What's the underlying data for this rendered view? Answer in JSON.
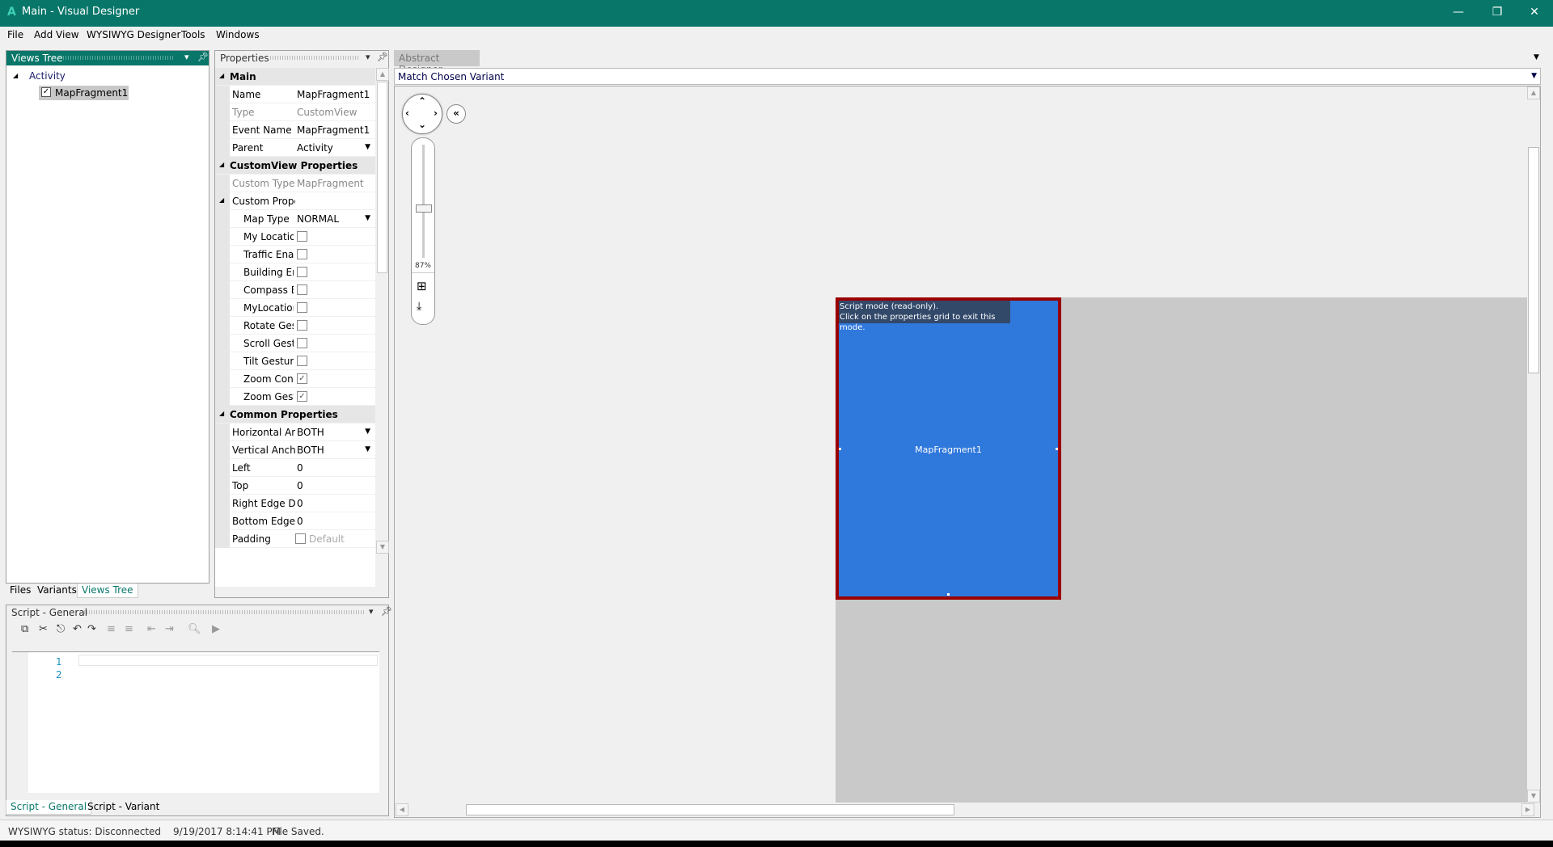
{
  "window": {
    "title": "Main - Visual Designer",
    "logo": "A",
    "controls": [
      "minimize-icon",
      "restore-icon",
      "close-icon"
    ]
  },
  "menu": [
    "File",
    "Add View",
    "WYSIWYG Designer",
    "Tools",
    "Windows"
  ],
  "views_tree": {
    "title": "Views Tree",
    "root": "Activity",
    "child": "MapFragment1",
    "child_checked": true,
    "tabs": [
      "Files",
      "Variants",
      "Views Tree"
    ],
    "active_tab": "Views Tree"
  },
  "properties": {
    "title": "Properties",
    "main": {
      "label": "Main",
      "rows": [
        [
          "Name",
          "MapFragment1"
        ],
        [
          "Type",
          "CustomView"
        ],
        [
          "Event Name",
          "MapFragment1"
        ],
        [
          "Parent",
          "Activity"
        ]
      ]
    },
    "custom": {
      "label": "CustomView Properties",
      "custom_type": [
        "Custom Type",
        "MapFragment"
      ],
      "custom_props": "Custom Prope",
      "map_type": [
        "Map Type",
        "NORMAL"
      ],
      "checks": [
        [
          "My Locatio",
          false
        ],
        [
          "Traffic Enal",
          false
        ],
        [
          "Building Er",
          false
        ],
        [
          "Compass E",
          false
        ],
        [
          "MyLocatioı",
          false
        ],
        [
          "Rotate Gest",
          false
        ],
        [
          "Scroll Gestu",
          false
        ],
        [
          "Tilt Gesture",
          false
        ],
        [
          "Zoom Cont",
          true
        ],
        [
          "Zoom Gest",
          true
        ]
      ]
    },
    "common": {
      "label": "Common Properties",
      "rows": [
        [
          "Horizontal An",
          "BOTH"
        ],
        [
          "Vertical Ancho",
          "BOTH"
        ],
        [
          "Left",
          "0"
        ],
        [
          "Top",
          "0"
        ],
        [
          "Right Edge Di",
          "0"
        ],
        [
          "Bottom Edge",
          "0"
        ]
      ],
      "padding": [
        "Padding",
        "Default"
      ]
    }
  },
  "script": {
    "title": "Script - General",
    "line_numbers": [
      "1",
      "2"
    ],
    "tabs": [
      "Script - General",
      "Script - Variant"
    ],
    "active_tab": "Script - General"
  },
  "designer": {
    "tab": "Abstract Designer",
    "variant": "Match Chosen Variant",
    "zoom_label": "87%",
    "zoom_percent": 87,
    "hint_line1": "Script mode (read-only).",
    "hint_line2": "Click on the properties grid to exit this mode.",
    "view_label": "MapFragment1",
    "view_color": "#2f78dc",
    "selection_color": "#9a0000"
  },
  "status": {
    "wysiwyg": "WYSIWYG status: Disconnected",
    "timestamp": "9/19/2017 8:14:41 PM",
    "message": "File Saved."
  },
  "colors": {
    "accent": "#08776a"
  }
}
